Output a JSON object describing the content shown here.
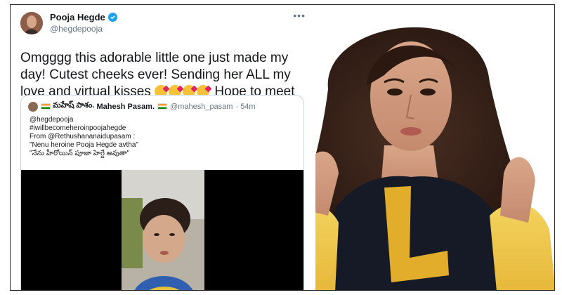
{
  "tweet": {
    "display_name": "Pooja Hegde",
    "handle": "@hegdepooja",
    "more_icon": "more-horizontal-icon",
    "verified_icon": "verified-badge-icon",
    "text_part1": "Omgggg this adorable little one just made my day! Cutest cheeks ever! Sending her ALL my love and virtual kisses ",
    "text_part2": " Hope to meet her some day ",
    "emoji_kiss": "face-blowing-kiss-emoji",
    "emoji_hug": "hugging-face-emoji"
  },
  "quote": {
    "name_prefix": "మహేష్ పాశం.",
    "name": "Mahesh Pasam.",
    "handle": "@mahesh_pasam",
    "time": "· 54m",
    "lines": [
      "@hegdepooja",
      "#iwillbecomeheroinpoojahegde",
      "From @Rethushananaidupasam :",
      "\"Nenu heroine Pooja Hegde avtha\"",
      "\"నేను హీరోయిన్ పూజా హెగ్డే అవుతా\""
    ]
  },
  "colors": {
    "verified": "#1da1f2",
    "text": "#14171a",
    "secondary": "#657786",
    "border": "#ccd6dd",
    "shirt": "#151a26",
    "shirt_print": "#e1ad2a"
  }
}
